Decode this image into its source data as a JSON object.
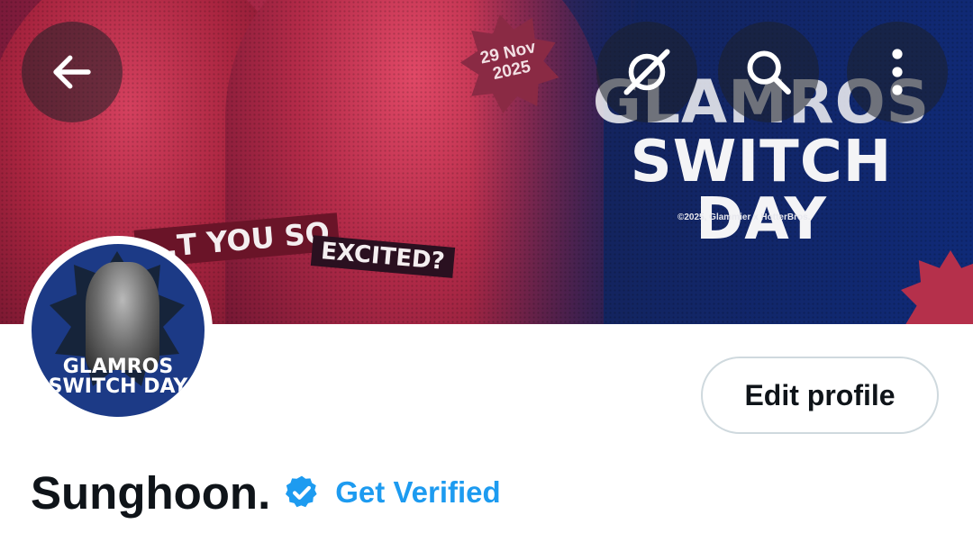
{
  "banner": {
    "date_line1": "29 Nov",
    "date_line2": "2025",
    "headline_line1": "GLAMROS",
    "headline_line2": "SWITCH DAY",
    "copyright": "©2025, Glammier x HotterBros.",
    "sticker_1": "...T YOU SO",
    "sticker_2": "EXCITED?"
  },
  "header_icons": {
    "back": "back-arrow-icon",
    "discover": "grok-icon",
    "search": "search-icon",
    "more": "more-vertical-icon"
  },
  "avatar": {
    "text_line1": "GLAMROS",
    "text_line2": "SWITCH DAY"
  },
  "actions": {
    "edit_profile_label": "Edit profile"
  },
  "profile": {
    "display_name": "Sunghoon.",
    "get_verified_label": "Get Verified"
  },
  "colors": {
    "accent": "#1d9bf0",
    "text": "#0f1419",
    "border": "#cfd9de"
  }
}
